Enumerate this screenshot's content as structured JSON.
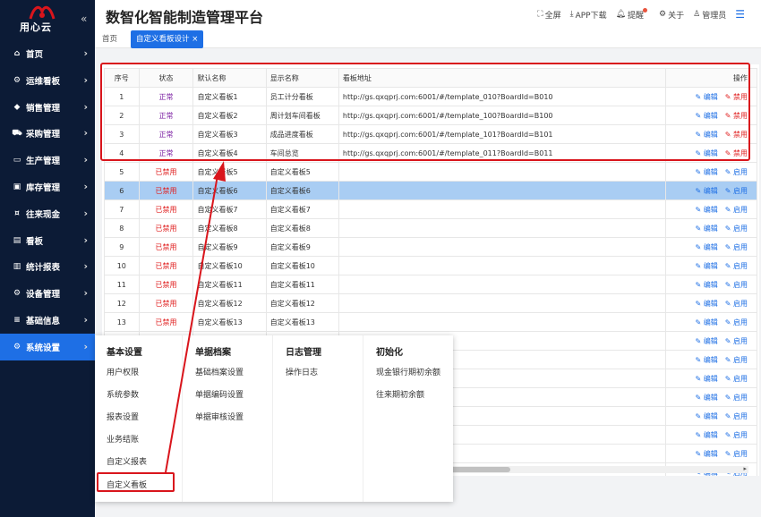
{
  "sidebar": {
    "logo_text": "用心云",
    "items": [
      {
        "label": "首页",
        "icon": "home-icon"
      },
      {
        "label": "运维看板",
        "icon": "gear-icon"
      },
      {
        "label": "销售管理",
        "icon": "tag-icon"
      },
      {
        "label": "采购管理",
        "icon": "cart-icon"
      },
      {
        "label": "生产管理",
        "icon": "monitor-icon"
      },
      {
        "label": "库存管理",
        "icon": "box-icon"
      },
      {
        "label": "往来现金",
        "icon": "money-icon"
      },
      {
        "label": "看板",
        "icon": "board-icon"
      },
      {
        "label": "统计报表",
        "icon": "bar-chart-icon"
      },
      {
        "label": "设备管理",
        "icon": "gear-icon"
      },
      {
        "label": "基础信息",
        "icon": "sliders-icon"
      },
      {
        "label": "系统设置",
        "icon": "gear-icon"
      }
    ]
  },
  "header": {
    "title": "数智化智能制造管理平台",
    "fullscreen": "全屏",
    "app_download": "APP下载",
    "remind": "提醒",
    "about": "关于",
    "user": "管理员"
  },
  "tabs": {
    "home": "首页",
    "active": "自定义看板设计",
    "close": "×"
  },
  "table": {
    "headers": [
      "序号",
      "状态",
      "默认名称",
      "显示名称",
      "看板地址",
      "操作"
    ],
    "edit_label": "编辑",
    "delete_label": "禁用",
    "enable_label": "启用",
    "rows": [
      {
        "no": "1",
        "status": "正常",
        "default_name": "自定义看板1",
        "display_name": "员工计分看板",
        "url": "http://gs.qxqprj.com:6001/#/template_010?BoardId=B010"
      },
      {
        "no": "2",
        "status": "正常",
        "default_name": "自定义看板2",
        "display_name": "周计划车间看板",
        "url": "http://gs.qxqprj.com:6001/#/template_100?BoardId=B100"
      },
      {
        "no": "3",
        "status": "正常",
        "default_name": "自定义看板3",
        "display_name": "成品进度看板",
        "url": "http://gs.qxqprj.com:6001/#/template_101?BoardId=B101"
      },
      {
        "no": "4",
        "status": "正常",
        "default_name": "自定义看板4",
        "display_name": "车间总览",
        "url": "http://gs.qxqprj.com:6001/#/template_011?BoardId=B011"
      },
      {
        "no": "5",
        "status": "已禁用",
        "default_name": "自定义看板5",
        "display_name": "自定义看板5",
        "url": ""
      },
      {
        "no": "6",
        "status": "已禁用",
        "default_name": "自定义看板6",
        "display_name": "自定义看板6",
        "url": ""
      },
      {
        "no": "7",
        "status": "已禁用",
        "default_name": "自定义看板7",
        "display_name": "自定义看板7",
        "url": ""
      },
      {
        "no": "8",
        "status": "已禁用",
        "default_name": "自定义看板8",
        "display_name": "自定义看板8",
        "url": ""
      },
      {
        "no": "9",
        "status": "已禁用",
        "default_name": "自定义看板9",
        "display_name": "自定义看板9",
        "url": ""
      },
      {
        "no": "10",
        "status": "已禁用",
        "default_name": "自定义看板10",
        "display_name": "自定义看板10",
        "url": ""
      },
      {
        "no": "11",
        "status": "已禁用",
        "default_name": "自定义看板11",
        "display_name": "自定义看板11",
        "url": ""
      },
      {
        "no": "12",
        "status": "已禁用",
        "default_name": "自定义看板12",
        "display_name": "自定义看板12",
        "url": ""
      },
      {
        "no": "13",
        "status": "已禁用",
        "default_name": "自定义看板13",
        "display_name": "自定义看板13",
        "url": ""
      },
      {
        "no": "",
        "status": "",
        "default_name": "",
        "display_name": "",
        "url": ""
      },
      {
        "no": "",
        "status": "",
        "default_name": "",
        "display_name": "",
        "url": ""
      },
      {
        "no": "",
        "status": "",
        "default_name": "",
        "display_name": "",
        "url": ""
      },
      {
        "no": "",
        "status": "",
        "default_name": "",
        "display_name": "",
        "url": ""
      },
      {
        "no": "",
        "status": "",
        "default_name": "",
        "display_name": "",
        "url": ""
      },
      {
        "no": "",
        "status": "",
        "default_name": "",
        "display_name": "",
        "url": ""
      },
      {
        "no": "",
        "status": "",
        "default_name": "",
        "display_name": "",
        "url": ""
      },
      {
        "no": "",
        "status": "",
        "default_name": "",
        "display_name": "",
        "url": ""
      }
    ]
  },
  "menu": {
    "col1": {
      "head": "基本设置",
      "items": [
        "用户权限",
        "系统参数",
        "报表设置",
        "业务结账",
        "自定义报表",
        "自定义看板"
      ]
    },
    "col2": {
      "head": "单据档案",
      "items": [
        "基础档案设置",
        "单据编码设置",
        "单据审核设置"
      ]
    },
    "col3": {
      "head": "日志管理",
      "items": [
        "操作日志"
      ]
    },
    "col4": {
      "head": "初始化",
      "items": [
        "现金银行期初余额",
        "往来期初余额"
      ]
    }
  },
  "colors": {
    "sidebar_bg": "#0c1b36",
    "accent": "#1e6fe5",
    "danger": "#e02020",
    "normal": "#7b1fa2"
  }
}
